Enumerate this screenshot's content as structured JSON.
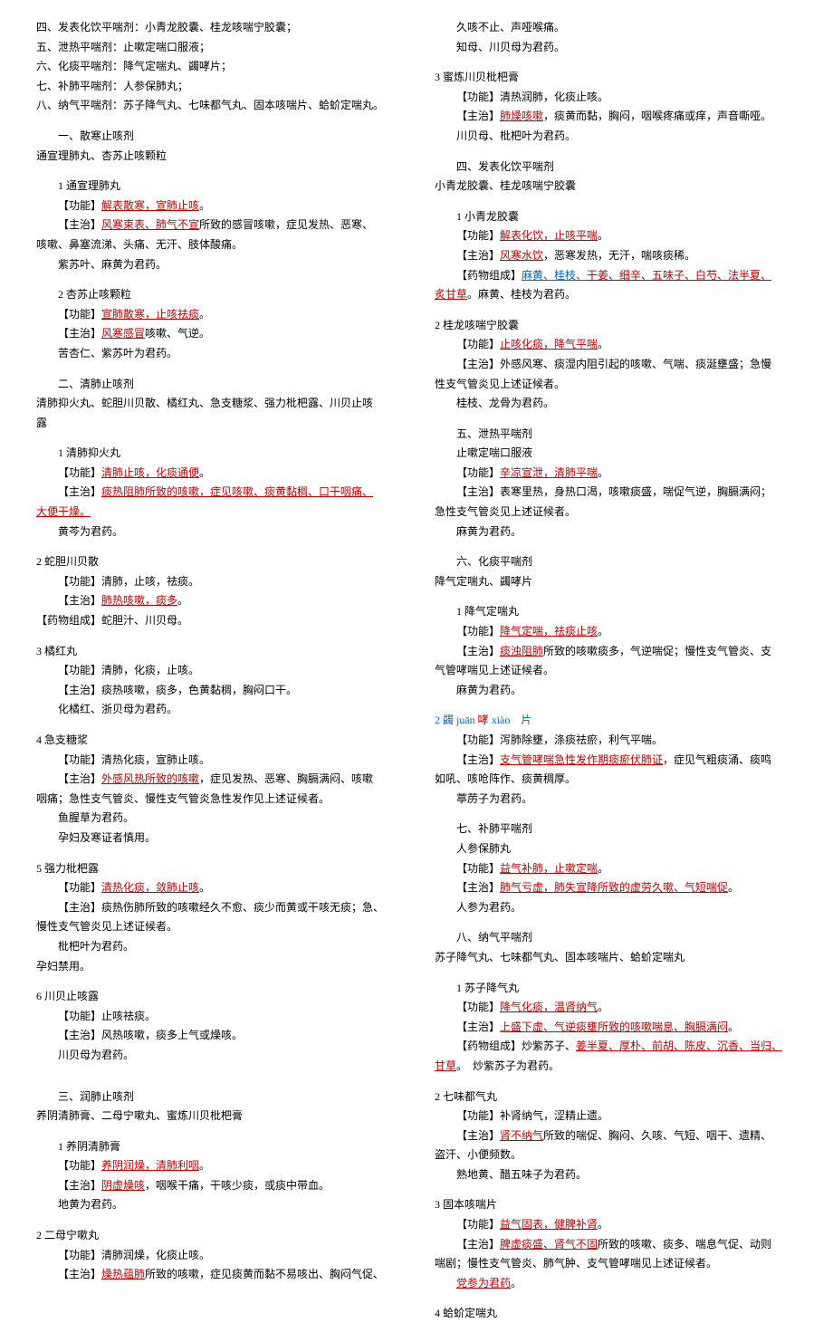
{
  "left": [
    {
      "cls": "line",
      "parts": [
        {
          "t": "四、发表化饮平喘剂：小青龙胶囊、桂龙咳喘宁胶囊；"
        }
      ]
    },
    {
      "cls": "line",
      "parts": [
        {
          "t": "五、泄热平喘剂：止嗽定喘口服液；"
        }
      ]
    },
    {
      "cls": "line",
      "parts": [
        {
          "t": "六、化痰平喘剂：降气定喘丸、蠲哮片；"
        }
      ]
    },
    {
      "cls": "line",
      "parts": [
        {
          "t": "七、补肺平喘剂：人参保肺丸；"
        }
      ]
    },
    {
      "cls": "line",
      "parts": [
        {
          "t": "八、纳气平喘剂：苏子降气丸、七味都气丸、固本咳喘片、蛤蚧定喘丸。"
        }
      ]
    },
    {
      "cls": "spacer"
    },
    {
      "cls": "line indent1",
      "parts": [
        {
          "t": "一、散寒止咳剂"
        }
      ]
    },
    {
      "cls": "line",
      "parts": [
        {
          "t": "通宣理肺丸、杏苏止咳颗粒"
        }
      ]
    },
    {
      "cls": "spacer"
    },
    {
      "cls": "line indent1",
      "parts": [
        {
          "t": "1 通宣理肺丸"
        }
      ]
    },
    {
      "cls": "line indent1",
      "parts": [
        {
          "t": "【功能】"
        },
        {
          "t": "解表散寒，宣肺止咳",
          "cls": "red underline"
        },
        {
          "t": "。"
        }
      ]
    },
    {
      "cls": "line indent1",
      "parts": [
        {
          "t": "【主治】"
        },
        {
          "t": "风寒束表、肺气不宣",
          "cls": "red underline"
        },
        {
          "t": "所致的感冒咳嗽，症见发热、恶寒、"
        }
      ]
    },
    {
      "cls": "line",
      "parts": [
        {
          "t": "咳嗽、鼻塞流涕、头痛、无汗、肢体酸痛。"
        }
      ]
    },
    {
      "cls": "line indent1",
      "parts": [
        {
          "t": "紫苏叶、麻黄为君药。"
        }
      ]
    },
    {
      "cls": "spacer"
    },
    {
      "cls": "line indent1",
      "parts": [
        {
          "t": "2 杏苏止咳颗粒"
        }
      ]
    },
    {
      "cls": "line indent1",
      "parts": [
        {
          "t": "【功能】"
        },
        {
          "t": "宣肺散寒，止咳祛痰",
          "cls": "red underline"
        },
        {
          "t": "。"
        }
      ]
    },
    {
      "cls": "line indent1",
      "parts": [
        {
          "t": "【主治】"
        },
        {
          "t": "风寒感冒",
          "cls": "red underline"
        },
        {
          "t": "咳嗽、气逆。"
        }
      ]
    },
    {
      "cls": "line indent1",
      "parts": [
        {
          "t": "苦杏仁、紫苏叶为君药。"
        }
      ]
    },
    {
      "cls": "spacer"
    },
    {
      "cls": "line indent1",
      "parts": [
        {
          "t": "二、清肺止咳剂"
        }
      ]
    },
    {
      "cls": "line",
      "parts": [
        {
          "t": "清肺抑火丸、蛇胆川贝散、橘红丸、急支糖浆、强力枇杷露、川贝止咳"
        }
      ]
    },
    {
      "cls": "line",
      "parts": [
        {
          "t": "露"
        }
      ]
    },
    {
      "cls": "spacer"
    },
    {
      "cls": "line indent1",
      "parts": [
        {
          "t": "1 清肺抑火丸"
        }
      ]
    },
    {
      "cls": "line indent1",
      "parts": [
        {
          "t": "【功能】"
        },
        {
          "t": "清肺止咳，化痰通便",
          "cls": "red underline"
        },
        {
          "t": "。"
        }
      ]
    },
    {
      "cls": "line indent1",
      "parts": [
        {
          "t": "【主治】"
        },
        {
          "t": "痰热阻肺所致的咳嗽，症见咳嗽、痰黄黏稠、口干咽痛、",
          "cls": "red underline"
        }
      ]
    },
    {
      "cls": "line",
      "parts": [
        {
          "t": "大便干燥。",
          "cls": "red underline"
        }
      ]
    },
    {
      "cls": "line indent1",
      "parts": [
        {
          "t": "黄芩为君药。"
        }
      ]
    },
    {
      "cls": "spacer"
    },
    {
      "cls": "line",
      "parts": [
        {
          "t": "2 蛇胆川贝散"
        }
      ]
    },
    {
      "cls": "line indent1",
      "parts": [
        {
          "t": "【功能】清肺，止咳，祛痰。"
        }
      ]
    },
    {
      "cls": "line indent1",
      "parts": [
        {
          "t": "【主治】"
        },
        {
          "t": "肺热咳嗽，痰多",
          "cls": "red underline"
        },
        {
          "t": "。"
        }
      ]
    },
    {
      "cls": "line",
      "parts": [
        {
          "t": "【药物组成】蛇胆汁、川贝母。"
        }
      ]
    },
    {
      "cls": "spacer"
    },
    {
      "cls": "line",
      "parts": [
        {
          "t": "3 橘红丸"
        }
      ]
    },
    {
      "cls": "line indent1",
      "parts": [
        {
          "t": "【功能】清肺，化痰，止咳。"
        }
      ]
    },
    {
      "cls": "line indent1",
      "parts": [
        {
          "t": "【主治】痰热咳嗽，痰多，色黄黏稠，胸闷口干。"
        }
      ]
    },
    {
      "cls": "line indent1",
      "parts": [
        {
          "t": "化橘红、浙贝母为君药。"
        }
      ]
    },
    {
      "cls": "spacer"
    },
    {
      "cls": "line",
      "parts": [
        {
          "t": "4 急支糖浆"
        }
      ]
    },
    {
      "cls": "line indent1",
      "parts": [
        {
          "t": "【功能】清热化痰，宣肺止咳。"
        }
      ]
    },
    {
      "cls": "line indent1",
      "parts": [
        {
          "t": "【主治】"
        },
        {
          "t": "外感风热所致的咳嗽",
          "cls": "red underline"
        },
        {
          "t": "，症见发热、恶寒、胸膈满闷、咳嗽"
        }
      ]
    },
    {
      "cls": "line",
      "parts": [
        {
          "t": "咽痛；急性支气管炎、慢性支气管炎急性发作见上述证候者。"
        }
      ]
    },
    {
      "cls": "line indent1",
      "parts": [
        {
          "t": "鱼腥草为君药。"
        }
      ]
    },
    {
      "cls": "line indent1",
      "parts": [
        {
          "t": "孕妇及寒证者慎用。"
        }
      ]
    },
    {
      "cls": "spacer"
    },
    {
      "cls": "line",
      "parts": [
        {
          "t": "5 强力枇杷露"
        }
      ]
    },
    {
      "cls": "line indent1",
      "parts": [
        {
          "t": "【功能】"
        },
        {
          "t": "清热化痰，敛肺止咳",
          "cls": "red underline"
        },
        {
          "t": "。"
        }
      ]
    },
    {
      "cls": "line indent1",
      "parts": [
        {
          "t": "【主治】痰热伤肺所致的咳嗽经久不愈、痰少而黄或干咳无痰；急、"
        }
      ]
    },
    {
      "cls": "line",
      "parts": [
        {
          "t": "慢性支气管炎见上述证候者。"
        }
      ]
    },
    {
      "cls": "line indent1",
      "parts": [
        {
          "t": "枇杷叶为君药。"
        }
      ]
    },
    {
      "cls": "line",
      "parts": [
        {
          "t": "孕妇禁用。"
        }
      ]
    },
    {
      "cls": "spacer"
    },
    {
      "cls": "line",
      "parts": [
        {
          "t": "6 川贝止咳露"
        }
      ]
    },
    {
      "cls": "line indent1",
      "parts": [
        {
          "t": "【功能】止咳祛痰。"
        }
      ]
    },
    {
      "cls": "line indent1",
      "parts": [
        {
          "t": "【主治】风热咳嗽，痰多上气或燥咳。"
        }
      ]
    },
    {
      "cls": "line indent1",
      "parts": [
        {
          "t": "川贝母为君药。"
        }
      ]
    },
    {
      "cls": "spacer"
    },
    {
      "cls": "spacer"
    },
    {
      "cls": "line indent1",
      "parts": [
        {
          "t": "三、润肺止咳剂"
        }
      ]
    },
    {
      "cls": "line",
      "parts": [
        {
          "t": "养阴清肺膏、二母宁嗽丸、蜜炼川贝枇杷膏"
        }
      ]
    },
    {
      "cls": "spacer"
    },
    {
      "cls": "line indent1",
      "parts": [
        {
          "t": "1 养阴清肺膏"
        }
      ]
    },
    {
      "cls": "line indent1",
      "parts": [
        {
          "t": "【功能】"
        },
        {
          "t": "养阴润燥，清肺利咽",
          "cls": "red underline"
        },
        {
          "t": "。"
        }
      ]
    },
    {
      "cls": "line indent1",
      "parts": [
        {
          "t": "【主治】"
        },
        {
          "t": "阴虚燥咳",
          "cls": "red underline"
        },
        {
          "t": "，咽喉干痛，干咳少痰，或痰中带血。"
        }
      ]
    },
    {
      "cls": "line indent1",
      "parts": [
        {
          "t": "地黄为君药。"
        }
      ]
    },
    {
      "cls": "spacer"
    },
    {
      "cls": "line",
      "parts": [
        {
          "t": "2 二母宁嗽丸"
        }
      ]
    },
    {
      "cls": "line indent1",
      "parts": [
        {
          "t": "【功能】清肺润燥，化痰止咳。"
        }
      ]
    },
    {
      "cls": "line indent1",
      "parts": [
        {
          "t": "【主治】"
        },
        {
          "t": "燥热蕴肺",
          "cls": "red underline"
        },
        {
          "t": "所致的咳嗽，症见痰黄而黏不易咳出、胸闷气促、"
        }
      ]
    }
  ],
  "right": [
    {
      "cls": "line indent1",
      "parts": [
        {
          "t": "久咳不止、声哑喉痛。"
        }
      ]
    },
    {
      "cls": "line indent1",
      "parts": [
        {
          "t": "知母、川贝母为君药。"
        }
      ]
    },
    {
      "cls": "spacer"
    },
    {
      "cls": "line",
      "parts": [
        {
          "t": "3 蜜炼川贝枇杷膏"
        }
      ]
    },
    {
      "cls": "line indent1",
      "parts": [
        {
          "t": "【功能】清热润肺，化痰止咳。"
        }
      ]
    },
    {
      "cls": "line indent1",
      "parts": [
        {
          "t": "【主治】"
        },
        {
          "t": "肺燥咳嗽",
          "cls": "red underline"
        },
        {
          "t": "，痰黄而黏，胸闷，咽喉疼痛或痒，声音嘶哑。"
        }
      ]
    },
    {
      "cls": "line indent1",
      "parts": [
        {
          "t": "川贝母、枇杷叶为君药。"
        }
      ]
    },
    {
      "cls": "spacer"
    },
    {
      "cls": "line indent1",
      "parts": [
        {
          "t": "四、发表化饮平喘剂"
        }
      ]
    },
    {
      "cls": "line",
      "parts": [
        {
          "t": "小青龙胶囊、桂龙咳喘宁胶囊"
        }
      ]
    },
    {
      "cls": "spacer"
    },
    {
      "cls": "line indent1",
      "parts": [
        {
          "t": "1 小青龙胶囊"
        }
      ]
    },
    {
      "cls": "line indent1",
      "parts": [
        {
          "t": "【功能】"
        },
        {
          "t": "解表化饮，止咳平喘",
          "cls": "red underline"
        },
        {
          "t": "。"
        }
      ]
    },
    {
      "cls": "line indent1",
      "parts": [
        {
          "t": "【主治】"
        },
        {
          "t": "风寒水饮",
          "cls": "red underline"
        },
        {
          "t": "，恶寒发热，无汗，喘咳痰稀。"
        }
      ]
    },
    {
      "cls": "line indent1",
      "parts": [
        {
          "t": "【药物组成】"
        },
        {
          "t": "麻黄、桂枝、",
          "cls": "blue underline"
        },
        {
          "t": "干姜、细辛、五味子、白芍、法半夏、",
          "cls": "red underline"
        }
      ]
    },
    {
      "cls": "line",
      "parts": [
        {
          "t": "炙甘草",
          "cls": "red underline"
        },
        {
          "t": "。麻黄、桂枝为君药。"
        }
      ]
    },
    {
      "cls": "spacer"
    },
    {
      "cls": "line",
      "parts": [
        {
          "t": "2 桂龙咳喘宁胶囊"
        }
      ]
    },
    {
      "cls": "line indent1",
      "parts": [
        {
          "t": "【功能】"
        },
        {
          "t": "止咳化痰，降气平喘",
          "cls": "red underline"
        },
        {
          "t": "。"
        }
      ]
    },
    {
      "cls": "line indent1",
      "parts": [
        {
          "t": "【主治】外感风寒、痰湿内阻引起的咳嗽、气喘、痰涎壅盛；急慢"
        }
      ]
    },
    {
      "cls": "line",
      "parts": [
        {
          "t": "性支气管炎见上述证候者。"
        }
      ]
    },
    {
      "cls": "line indent1",
      "parts": [
        {
          "t": "桂枝、龙骨为君药。"
        }
      ]
    },
    {
      "cls": "spacer"
    },
    {
      "cls": "line indent1",
      "parts": [
        {
          "t": "五、泄热平喘剂"
        }
      ]
    },
    {
      "cls": "line indent1",
      "parts": [
        {
          "t": "止嗽定喘口服液"
        }
      ]
    },
    {
      "cls": "line indent1",
      "parts": [
        {
          "t": "【功能】"
        },
        {
          "t": "辛凉宣泄，清肺平喘",
          "cls": "red underline"
        },
        {
          "t": "。"
        }
      ]
    },
    {
      "cls": "line indent1",
      "parts": [
        {
          "t": "【主治】表寒里热，身热口渴，咳嗽痰盛，喘促气逆，胸膈满闷；"
        }
      ]
    },
    {
      "cls": "line",
      "parts": [
        {
          "t": "急性支气管炎见上述证候者。"
        }
      ]
    },
    {
      "cls": "line indent1",
      "parts": [
        {
          "t": "麻黄为君药。"
        }
      ]
    },
    {
      "cls": "spacer"
    },
    {
      "cls": "line indent1",
      "parts": [
        {
          "t": "六、化痰平喘剂"
        }
      ]
    },
    {
      "cls": "line",
      "parts": [
        {
          "t": "降气定喘丸、蠲哮片"
        }
      ]
    },
    {
      "cls": "spacer"
    },
    {
      "cls": "line indent1",
      "parts": [
        {
          "t": "1 降气定喘丸"
        }
      ]
    },
    {
      "cls": "line indent1",
      "parts": [
        {
          "t": "【功能】"
        },
        {
          "t": "降气定喘，祛痰止咳",
          "cls": "red underline"
        },
        {
          "t": "。"
        }
      ]
    },
    {
      "cls": "line indent1",
      "parts": [
        {
          "t": "【主治】"
        },
        {
          "t": "痰浊阻肺",
          "cls": "red underline"
        },
        {
          "t": "所致的咳嗽痰多，气逆喘促；慢性支气管炎、支"
        }
      ]
    },
    {
      "cls": "line",
      "parts": [
        {
          "t": "气管哮喘见上述证候者。"
        }
      ]
    },
    {
      "cls": "line indent1",
      "parts": [
        {
          "t": "麻黄为君药。"
        }
      ]
    },
    {
      "cls": "spacer"
    },
    {
      "cls": "line",
      "parts": [
        {
          "t": "2 蠲 juān ",
          "cls": "blue"
        },
        {
          "t": "哮 ",
          "cls": "red"
        },
        {
          "t": "xiào　片",
          "cls": "blue"
        }
      ]
    },
    {
      "cls": "line indent1",
      "parts": [
        {
          "t": "【功能】泻肺除壅，涤痰祛瘀，利气平喘。"
        }
      ]
    },
    {
      "cls": "line indent1",
      "parts": [
        {
          "t": "【主治】"
        },
        {
          "t": "支气管哮喘急性发作期痰瘀伏肺证",
          "cls": "red underline"
        },
        {
          "t": "，症见气粗痰涌、痰鸣"
        }
      ]
    },
    {
      "cls": "line",
      "parts": [
        {
          "t": "如吼、咳呛阵作、痰黄稠厚。"
        }
      ]
    },
    {
      "cls": "line indent1",
      "parts": [
        {
          "t": "葶苈子为君药。"
        }
      ]
    },
    {
      "cls": "spacer"
    },
    {
      "cls": "line indent1",
      "parts": [
        {
          "t": "七、补肺平喘剂"
        }
      ]
    },
    {
      "cls": "line indent1",
      "parts": [
        {
          "t": "人参保肺丸"
        }
      ]
    },
    {
      "cls": "line indent1",
      "parts": [
        {
          "t": "【功能】"
        },
        {
          "t": "益气补肺，止嗽定喘",
          "cls": "red underline"
        },
        {
          "t": "。"
        }
      ]
    },
    {
      "cls": "line indent1",
      "parts": [
        {
          "t": "【主治】"
        },
        {
          "t": "肺气亏虚，肺失宣降所致的虚劳久嗽、气短喘促",
          "cls": "red underline"
        },
        {
          "t": "。"
        }
      ]
    },
    {
      "cls": "line indent1",
      "parts": [
        {
          "t": "人参为君药。"
        }
      ]
    },
    {
      "cls": "spacer"
    },
    {
      "cls": "line indent1",
      "parts": [
        {
          "t": "八、纳气平喘剂"
        }
      ]
    },
    {
      "cls": "line",
      "parts": [
        {
          "t": "苏子降气丸、七味都气丸、固本咳喘片、蛤蚧定喘丸"
        }
      ]
    },
    {
      "cls": "spacer"
    },
    {
      "cls": "line indent1",
      "parts": [
        {
          "t": "1 苏子降气丸"
        }
      ]
    },
    {
      "cls": "line indent1",
      "parts": [
        {
          "t": "【功能】"
        },
        {
          "t": "降气化痰，温肾纳气",
          "cls": "red underline"
        },
        {
          "t": "。"
        }
      ]
    },
    {
      "cls": "line indent1",
      "parts": [
        {
          "t": "【主治】"
        },
        {
          "t": "上盛下虚、气逆痰壅所致的咳嗽喘息、胸膈满闷",
          "cls": "red underline"
        },
        {
          "t": "。"
        }
      ]
    },
    {
      "cls": "line indent1",
      "parts": [
        {
          "t": "【药物组成】炒紫苏子、"
        },
        {
          "t": "姜半夏、厚朴、前胡、陈皮、沉香、当归、",
          "cls": "red underline"
        }
      ]
    },
    {
      "cls": "line",
      "parts": [
        {
          "t": "甘草",
          "cls": "red underline"
        },
        {
          "t": "。　炒紫苏子为君药。"
        }
      ]
    },
    {
      "cls": "spacer"
    },
    {
      "cls": "line",
      "parts": [
        {
          "t": "2 七味都气丸"
        }
      ]
    },
    {
      "cls": "line indent1",
      "parts": [
        {
          "t": "【功能】补肾纳气，涩精止遗。"
        }
      ]
    },
    {
      "cls": "line indent1",
      "parts": [
        {
          "t": "【主治】"
        },
        {
          "t": "肾不纳气",
          "cls": "red underline"
        },
        {
          "t": "所致的喘促、胸闷、久咳、气短、咽干、遗精、"
        }
      ]
    },
    {
      "cls": "line",
      "parts": [
        {
          "t": "盗汗、小便频数。"
        }
      ]
    },
    {
      "cls": "line indent1",
      "parts": [
        {
          "t": "熟地黄、醋五味子为君药。"
        }
      ]
    },
    {
      "cls": "spacer"
    },
    {
      "cls": "line",
      "parts": [
        {
          "t": "3 固本咳喘片"
        }
      ]
    },
    {
      "cls": "line indent1",
      "parts": [
        {
          "t": "【功能】"
        },
        {
          "t": "益气固表，健脾补肾",
          "cls": "red underline"
        },
        {
          "t": "。"
        }
      ]
    },
    {
      "cls": "line indent1",
      "parts": [
        {
          "t": "【主治】"
        },
        {
          "t": "脾虚痰盛、肾气不固",
          "cls": "red underline"
        },
        {
          "t": "所致的咳嗽、痰多、喘息气促、动则"
        }
      ]
    },
    {
      "cls": "line",
      "parts": [
        {
          "t": "喘剧；慢性支气管炎、肺气肿、支气管哮喘见上述证候者。"
        }
      ]
    },
    {
      "cls": "line indent1",
      "parts": [
        {
          "t": "党参为君药",
          "cls": "red underline"
        },
        {
          "t": "。"
        }
      ]
    },
    {
      "cls": "spacer"
    },
    {
      "cls": "line",
      "parts": [
        {
          "t": "4 蛤蚧定喘丸"
        }
      ]
    }
  ]
}
